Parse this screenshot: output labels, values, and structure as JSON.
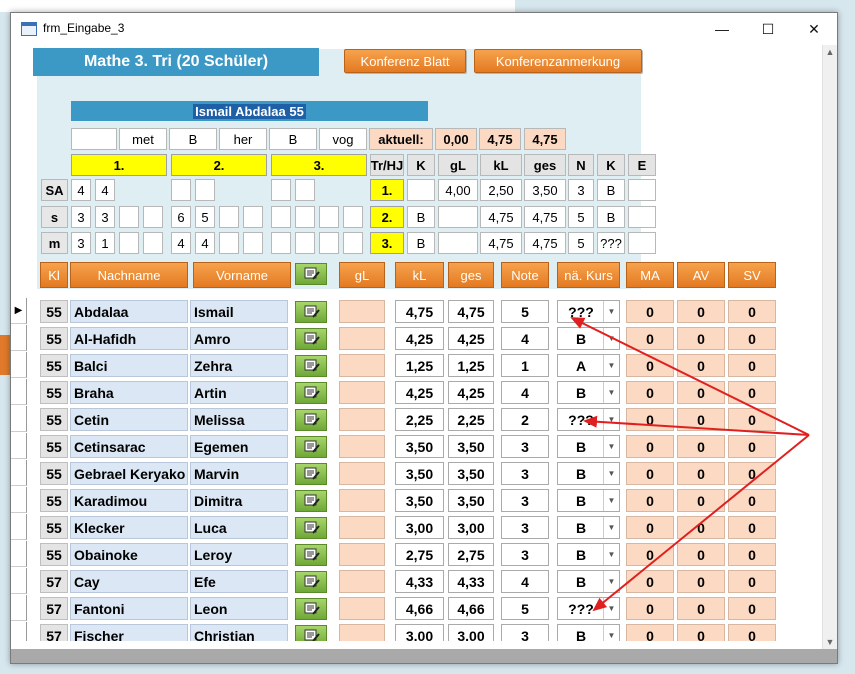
{
  "window": {
    "title": "frm_Eingabe_3"
  },
  "window_controls": {
    "minimize": "—",
    "maximize": "☐",
    "close": "✕"
  },
  "header": {
    "title": "Mathe   3. Tri  (20 Schüler)",
    "konferenz_blatt": "Konferenz Blatt",
    "konferenzanmerkung": "Konferenzanmerkung",
    "student_name": "Ismail Abdalaa 55"
  },
  "summary": {
    "row1": [
      "",
      "met",
      "B",
      "her",
      "B",
      "vog"
    ],
    "aktuell_label": "aktuell:",
    "aktuell_values": [
      "0,00",
      "4,75",
      "4,75"
    ],
    "tri_headers": [
      "1.",
      "2.",
      "3."
    ],
    "grade_headers": [
      "Tr/HJ",
      "K",
      "gL",
      "kL",
      "ges",
      "N",
      "K",
      "E"
    ],
    "rows": [
      {
        "label": "SA",
        "a": [
          "4",
          "4",
          "",
          ""
        ],
        "tr": "1.",
        "k": "",
        "gl": "4,00",
        "kl": "2,50",
        "ges": "3,50",
        "n": "3",
        "k2": "B",
        "e": ""
      },
      {
        "label": "s",
        "a": [
          "3",
          "3",
          "",
          ""
        ],
        "b": [
          "6",
          "5",
          "",
          ""
        ],
        "tr": "2.",
        "k": "B",
        "gl": "",
        "kl": "4,75",
        "ges": "4,75",
        "n": "5",
        "k2": "B",
        "e": ""
      },
      {
        "label": "m",
        "a": [
          "3",
          "1",
          "",
          ""
        ],
        "b": [
          "4",
          "4",
          "",
          ""
        ],
        "tr": "3.",
        "k": "B",
        "gl": "",
        "kl": "4,75",
        "ges": "4,75",
        "n": "5",
        "k2": "???",
        "e": ""
      }
    ]
  },
  "columns": [
    "Kl",
    "Nachname",
    "Vorname",
    "gL",
    "kL",
    "ges",
    "Note",
    "nä. Kurs",
    "MA",
    "AV",
    "SV"
  ],
  "students": [
    {
      "kl": "55",
      "nachname": "Abdalaa",
      "vorname": "Ismail",
      "gl": "",
      "kl2": "4,75",
      "ges": "4,75",
      "note": "5",
      "kurs": "???",
      "ma": "0",
      "av": "0",
      "sv": "0",
      "current": true
    },
    {
      "kl": "55",
      "nachname": "Al-Hafidh",
      "vorname": "Amro",
      "gl": "",
      "kl2": "4,25",
      "ges": "4,25",
      "note": "4",
      "kurs": "B",
      "ma": "0",
      "av": "0",
      "sv": "0"
    },
    {
      "kl": "55",
      "nachname": "Balci",
      "vorname": "Zehra",
      "gl": "",
      "kl2": "1,25",
      "ges": "1,25",
      "note": "1",
      "kurs": "A",
      "ma": "0",
      "av": "0",
      "sv": "0"
    },
    {
      "kl": "55",
      "nachname": "Braha",
      "vorname": "Artin",
      "gl": "",
      "kl2": "4,25",
      "ges": "4,25",
      "note": "4",
      "kurs": "B",
      "ma": "0",
      "av": "0",
      "sv": "0"
    },
    {
      "kl": "55",
      "nachname": "Cetin",
      "vorname": "Melissa",
      "gl": "",
      "kl2": "2,25",
      "ges": "2,25",
      "note": "2",
      "kurs": "???",
      "ma": "0",
      "av": "0",
      "sv": "0"
    },
    {
      "kl": "55",
      "nachname": "Cetinsarac",
      "vorname": "Egemen",
      "gl": "",
      "kl2": "3,50",
      "ges": "3,50",
      "note": "3",
      "kurs": "B",
      "ma": "0",
      "av": "0",
      "sv": "0"
    },
    {
      "kl": "55",
      "nachname": "Gebrael Keryako",
      "vorname": "Marvin",
      "gl": "",
      "kl2": "3,50",
      "ges": "3,50",
      "note": "3",
      "kurs": "B",
      "ma": "0",
      "av": "0",
      "sv": "0"
    },
    {
      "kl": "55",
      "nachname": "Karadimou",
      "vorname": "Dimitra",
      "gl": "",
      "kl2": "3,50",
      "ges": "3,50",
      "note": "3",
      "kurs": "B",
      "ma": "0",
      "av": "0",
      "sv": "0"
    },
    {
      "kl": "55",
      "nachname": "Klecker",
      "vorname": "Luca",
      "gl": "",
      "kl2": "3,00",
      "ges": "3,00",
      "note": "3",
      "kurs": "B",
      "ma": "0",
      "av": "0",
      "sv": "0"
    },
    {
      "kl": "55",
      "nachname": "Obainoke",
      "vorname": "Leroy",
      "gl": "",
      "kl2": "2,75",
      "ges": "2,75",
      "note": "3",
      "kurs": "B",
      "ma": "0",
      "av": "0",
      "sv": "0"
    },
    {
      "kl": "57",
      "nachname": "Cay",
      "vorname": "Efe",
      "gl": "",
      "kl2": "4,33",
      "ges": "4,33",
      "note": "4",
      "kurs": "B",
      "ma": "0",
      "av": "0",
      "sv": "0"
    },
    {
      "kl": "57",
      "nachname": "Fantoni",
      "vorname": "Leon",
      "gl": "",
      "kl2": "4,66",
      "ges": "4,66",
      "note": "5",
      "kurs": "???",
      "ma": "0",
      "av": "0",
      "sv": "0"
    },
    {
      "kl": "57",
      "nachname": "Fischer",
      "vorname": "Christian",
      "gl": "",
      "kl2": "3,00",
      "ges": "3,00",
      "note": "3",
      "kurs": "B",
      "ma": "0",
      "av": "0",
      "sv": "0"
    }
  ],
  "colors": {
    "accent_blue": "#3c99c6",
    "orange": "#e37a22",
    "peach": "#fbd9c2",
    "yellow": "#ffff00",
    "arrow_red": "#e02020"
  },
  "icons": {
    "edit": "edit-note-icon",
    "record_selector": "current-record-arrow-icon",
    "dropdown": "chevron-down-icon"
  }
}
